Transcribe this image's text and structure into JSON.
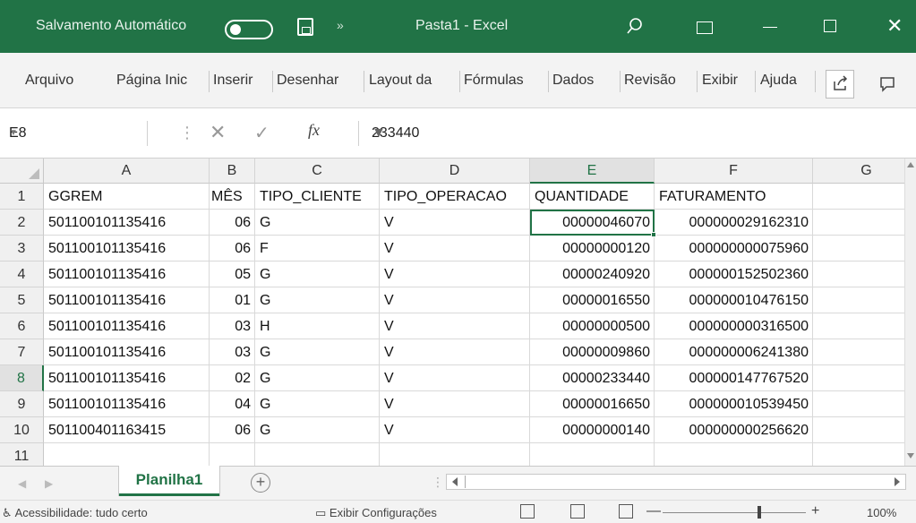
{
  "titlebar": {
    "autosave_label": "Salvamento Automático",
    "more_label": "»",
    "title": "Pasta1 - Excel",
    "close_label": "✕",
    "accent": "#217346"
  },
  "ribbon": {
    "tabs": [
      "Arquivo",
      "Página Inic",
      "Inserir",
      "Desenhar",
      "Layout da",
      "Fórmulas",
      "Dados",
      "Revisão",
      "Exibir",
      "Ajuda"
    ]
  },
  "formula_bar": {
    "name_box": "E8",
    "cancel": "✕",
    "enter": "✓",
    "fx": "fx",
    "value": "233440"
  },
  "grid": {
    "columns": [
      "A",
      "B",
      "C",
      "D",
      "E",
      "F",
      "G"
    ],
    "selected_column": "E",
    "selected_row": "8",
    "rows": [
      {
        "n": "1",
        "cells": [
          "GGREM",
          "MÊS",
          "TIPO_CLIENTE",
          "TIPO_OPERACAO",
          "QUANTIDADE",
          "FATURAMENTO",
          ""
        ]
      },
      {
        "n": "2",
        "cells": [
          "501100101135416",
          "06",
          "G",
          "V",
          "00000046070",
          "000000029162310",
          ""
        ]
      },
      {
        "n": "3",
        "cells": [
          "501100101135416",
          "06",
          "F",
          "V",
          "00000000120",
          "000000000075960",
          ""
        ]
      },
      {
        "n": "4",
        "cells": [
          "501100101135416",
          "05",
          "G",
          "V",
          "00000240920",
          "000000152502360",
          ""
        ]
      },
      {
        "n": "5",
        "cells": [
          "501100101135416",
          "01",
          "G",
          "V",
          "00000016550",
          "000000010476150",
          ""
        ]
      },
      {
        "n": "6",
        "cells": [
          "501100101135416",
          "03",
          "H",
          "V",
          "00000000500",
          "000000000316500",
          ""
        ]
      },
      {
        "n": "7",
        "cells": [
          "501100101135416",
          "03",
          "G",
          "V",
          "00000009860",
          "000000006241380",
          ""
        ]
      },
      {
        "n": "8",
        "cells": [
          "501100101135416",
          "02",
          "G",
          "V",
          "00000233440",
          "000000147767520",
          ""
        ]
      },
      {
        "n": "9",
        "cells": [
          "501100101135416",
          "04",
          "G",
          "V",
          "00000016650",
          "000000010539450",
          ""
        ]
      },
      {
        "n": "10",
        "cells": [
          "501100401163415",
          "06",
          "G",
          "V",
          "00000000140",
          "000000000256620",
          ""
        ]
      },
      {
        "n": "11",
        "cells": [
          "",
          "",
          "",
          "",
          "",
          "",
          ""
        ]
      }
    ]
  },
  "sheets": {
    "tabs": [
      "Planilha1"
    ],
    "add_label": "+"
  },
  "status": {
    "accessibility": "Acessibilidade: tudo certo",
    "display_settings": "Exibir Configurações",
    "zoom_minus": "—",
    "zoom_plus": "+",
    "zoom": "100%"
  }
}
